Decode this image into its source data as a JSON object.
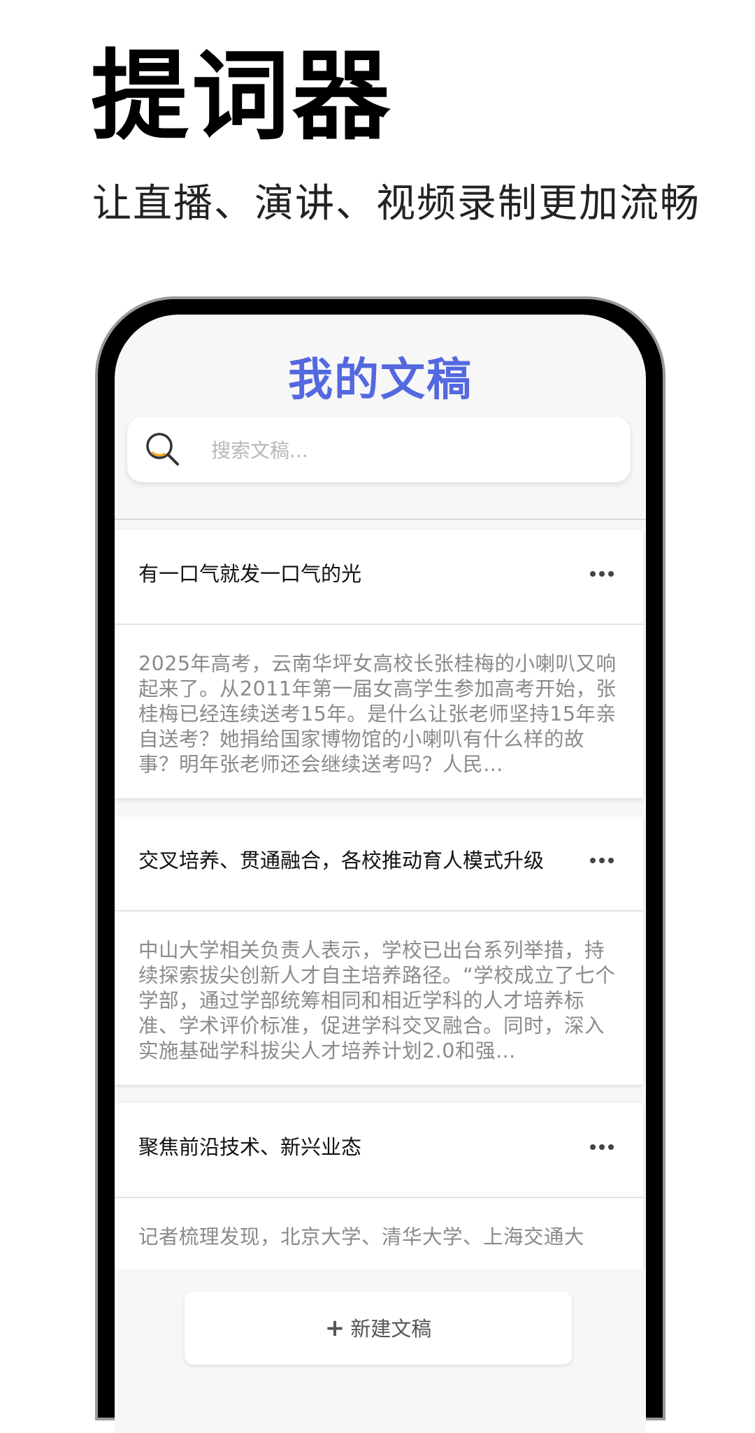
{
  "promo": {
    "title": "提词器",
    "subtitle": "让直播、演讲、视频录制更加流畅"
  },
  "app": {
    "title": "我的文稿",
    "accent_color": "#5468e0"
  },
  "search": {
    "placeholder": "搜索文稿...",
    "value": ""
  },
  "documents": [
    {
      "title": "有一口气就发一口气的光",
      "preview": "2025年高考，云南华坪女高校长张桂梅的小喇叭又响起来了。从2011年第一届女高学生参加高考开始，张桂梅已经连续送考15年。是什么让张老师坚持15年亲自送考？她捐给国家博物馆的小喇叭有什么样的故事？明年张老师还会继续送考吗？人民…"
    },
    {
      "title": "交叉培养、贯通融合，各校推动育人模式升级",
      "preview": "中山大学相关负责人表示，学校已出台系列举措，持续探索拔尖创新人才自主培养路径。“学校成立了七个学部，通过学部统筹相同和相近学科的人才培养标准、学术评价标准，促进学科交叉融合。同时，深入实施基础学科拔尖人才培养计划2.0和强…"
    },
    {
      "title": "聚焦前沿技术、新兴业态",
      "preview": "记者梳理发现，北京大学、清华大学、上海交通大"
    }
  ],
  "actions": {
    "new_doc_label": "新建文稿",
    "more_icon": "more-horizontal-icon",
    "plus_icon": "plus-icon"
  }
}
